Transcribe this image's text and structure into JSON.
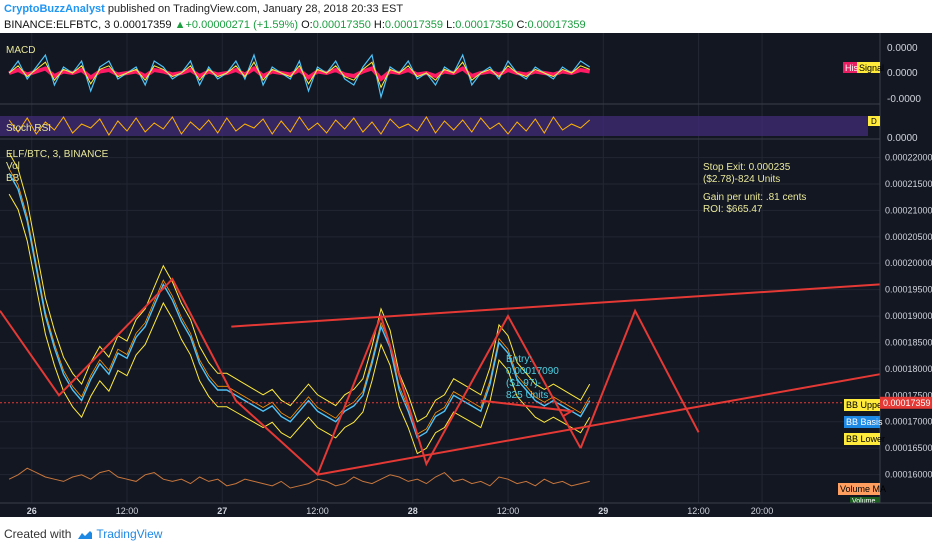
{
  "header": {
    "author": "CryptoBuzzAnalyst",
    "published": "published on TradingView.com, January 28, 2018 20:33 EST",
    "symbol": "BINANCE:ELFBTC, 3",
    "last": "0.00017359",
    "change": "+0.00000271 (+1.59%)",
    "o_label": "O:",
    "o_value": "0.00017350",
    "h_label": "H:",
    "h_value": "0.00017359",
    "l_label": "L:",
    "l_value": "0.00017350",
    "c_label": "C:",
    "c_value": "0.00017359"
  },
  "footer": {
    "created_with": "Created with",
    "brand": "TradingView"
  },
  "colors": {
    "bg": "#131722",
    "grid": "#2a2e39",
    "axis_text": "#d1d4dc",
    "trend": "#e53935",
    "price_label": "#e53935",
    "annotation": "#e8e89a",
    "entry_note": "#4dd0e1",
    "macd": "#4fc3f7",
    "signal": "#ffeb3b",
    "hist": "#ff1a66",
    "stoch": "#ffb300",
    "stoch_band": "#3f2a73"
  },
  "chart_data": {
    "type": "line",
    "title": "ELF/BTC, 3, BINANCE",
    "x_ticks": [
      "26",
      "12:00",
      "27",
      "12:00",
      "28",
      "12:00",
      "29",
      "12:00",
      "20:00"
    ],
    "y_ticks": [
      "0.00022000",
      "0.00021500",
      "0.00021000",
      "0.00020500",
      "0.00020000",
      "0.00019500",
      "0.00019000",
      "0.00018500",
      "0.00018000",
      "0.00017500",
      "0.00017000",
      "0.00016500",
      "0.00016000"
    ],
    "ylim": [
      0.000155,
      0.000222
    ],
    "last_price": "0.00017359",
    "last_price_value": 0.00017359,
    "price": {
      "x": [
        0,
        1,
        2,
        3,
        4,
        5,
        6,
        7,
        8,
        9,
        10,
        11,
        12,
        13,
        14,
        15,
        16,
        17,
        18,
        19,
        20,
        21,
        22,
        23,
        24,
        25,
        26,
        27,
        28,
        29,
        30,
        31,
        32,
        33,
        34,
        35,
        36,
        37,
        38,
        39,
        40,
        41,
        42,
        43,
        44,
        45,
        46,
        47,
        48,
        49,
        50,
        51,
        52,
        53,
        54,
        55,
        56,
        57,
        58,
        59,
        60,
        61,
        62,
        63,
        64
      ],
      "y": [
        0.000217,
        0.000214,
        0.000208,
        0.000199,
        0.00019,
        0.000184,
        0.000179,
        0.000176,
        0.000174,
        0.000178,
        0.000181,
        0.000179,
        0.000183,
        0.000182,
        0.000186,
        0.000188,
        0.000192,
        0.000196,
        0.000193,
        0.000189,
        0.000186,
        0.000181,
        0.000178,
        0.000176,
        0.000176,
        0.000175,
        0.000174,
        0.000173,
        0.000172,
        0.000173,
        0.000171,
        0.00017,
        0.000172,
        0.000174,
        0.000172,
        0.000171,
        0.00017,
        0.000172,
        0.000173,
        0.000175,
        0.000181,
        0.000188,
        0.000184,
        0.000176,
        0.000172,
        0.000167,
        0.000168,
        0.000171,
        0.000172,
        0.000175,
        0.000174,
        0.000173,
        0.000172,
        0.000177,
        0.000185,
        0.000183,
        0.000178,
        0.000176,
        0.000174,
        0.000173,
        0.000174,
        0.000173,
        0.000172,
        0.000171,
        0.000174
      ]
    },
    "trendlines": [
      {
        "x": [
          -1,
          5.5,
          18,
          25,
          34,
          41,
          46,
          55,
          63
        ],
        "y": [
          0.000191,
          0.000175,
          0.000197,
          0.000174,
          0.00016,
          0.00019,
          0.000162,
          0.00019,
          0.000165
        ]
      },
      {
        "x": [
          24.5,
          96
        ],
        "y": [
          0.000188,
          0.000196
        ]
      },
      {
        "x": [
          34,
          96
        ],
        "y": [
          0.00016,
          0.000179
        ]
      },
      {
        "x": [
          63,
          69,
          76
        ],
        "y": [
          0.000165,
          0.000191,
          0.000168
        ]
      },
      {
        "x": [
          52,
          62,
          61
        ],
        "y": [
          0.000174,
          0.000172,
          0.000171
        ]
      }
    ],
    "x_range": [
      -1,
      96
    ],
    "volume_ma": [
      9,
      11,
      14,
      12,
      10,
      9,
      8,
      10,
      11,
      9,
      12,
      13,
      10,
      9,
      8,
      11,
      12,
      9,
      8,
      9,
      7,
      10,
      8,
      9,
      6,
      7,
      9,
      8,
      7,
      6,
      8,
      5,
      6,
      7,
      9,
      8,
      6,
      7,
      10,
      8,
      7,
      9,
      11,
      10,
      8,
      9,
      7,
      10,
      12,
      8,
      9,
      7,
      8,
      6,
      10,
      9,
      7,
      8,
      6,
      9,
      7,
      8,
      6,
      7,
      8
    ],
    "macd": [
      0,
      2,
      -1,
      1,
      3,
      -2,
      1,
      0,
      2,
      -3,
      1,
      2,
      -1,
      0,
      1,
      -2,
      2,
      1,
      -1,
      0,
      2,
      -2,
      1,
      -1,
      0,
      2,
      -1,
      3,
      -2,
      1,
      0,
      -1,
      2,
      -3,
      1,
      0,
      2,
      -1,
      -2,
      1,
      3,
      -4,
      1,
      0,
      2,
      -1,
      0,
      -2,
      1,
      0,
      3,
      -2,
      0,
      1,
      -1,
      2,
      0,
      -1,
      1,
      0,
      -1,
      1,
      0,
      2,
      1
    ],
    "stoch": [
      80,
      20,
      90,
      10,
      70,
      30,
      95,
      15,
      60,
      40,
      85,
      5,
      75,
      25,
      90,
      20,
      65,
      35,
      95,
      10,
      70,
      30,
      80,
      15,
      90,
      25,
      60,
      40,
      85,
      10,
      75,
      20,
      95,
      30,
      65,
      15,
      80,
      35,
      90,
      20,
      70,
      10,
      85,
      40,
      60,
      25,
      95,
      15,
      75,
      30,
      80,
      20,
      90,
      35,
      65,
      10,
      70,
      25,
      85,
      15,
      95,
      30,
      60,
      40,
      80
    ],
    "labels": {
      "macd": "MACD",
      "stoch": "Stoch RSI",
      "vol": "Vol",
      "bb": "BB",
      "hist": "Hist",
      "signal": "Signal",
      "stoch_badge": "D",
      "macd_axis": [
        "0.0000",
        "0.0000",
        "-0.0000"
      ],
      "stoch_axis": "0.0000",
      "bb_upper": "BB Upper",
      "bb_basis": "BB Basis",
      "bb_lower": "BB Lower",
      "volume_ma": "Volume MA",
      "volume": "Volume"
    },
    "notes": {
      "stop_l1": "Stop Exit: 0.000235",
      "stop_l2": "($2.78)-824 Units",
      "gain_l1": "Gain per unit: .81 cents",
      "gain_l2": "ROI: $665.47",
      "entry_l1": "Entry:",
      "entry_l2": "0.00017090",
      "entry_l3": "($1.97)-",
      "entry_l4": "825 Units"
    }
  }
}
